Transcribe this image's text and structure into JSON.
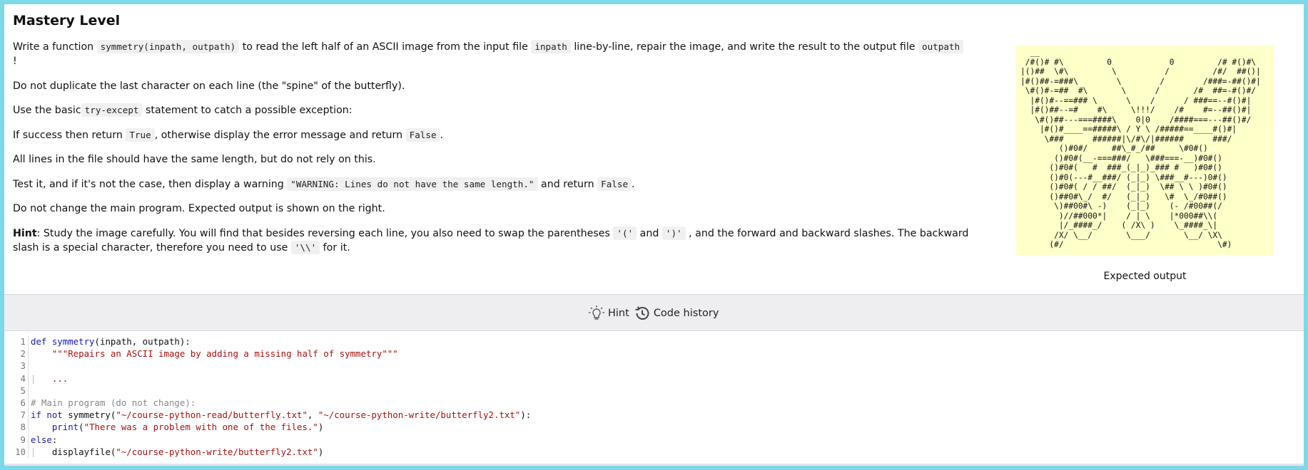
{
  "task": {
    "title": "Mastery Level",
    "p1": {
      "t1": "Write a function ",
      "c1": "symmetry(inpath, outpath)",
      "t2": " to read the left half of an ASCII image from the input file ",
      "c2": "inpath",
      "t3": " line-by-line, repair the image, and write the result to the output file ",
      "c3": "outpath",
      "t4": " !"
    },
    "p2": "Do not duplicate the last character on each line (the \"spine\" of the butterfly).",
    "p3": {
      "t1": "Use the basic",
      "c1": "try-except",
      "t2": " statement to catch a possible exception:"
    },
    "p4": {
      "t1": "If success then return ",
      "c1": "True",
      "t2": ", otherwise display the error message and return ",
      "c2": "False",
      "t3": "."
    },
    "p5": "All lines in the file should have the same length, but do not rely on this.",
    "p6": {
      "t1": "Test it, and if it's not the case, then display a warning ",
      "c1": "\"WARNING: Lines do not have the same length.\"",
      "t2": " and return ",
      "c2": "False",
      "t3": "."
    },
    "p7": "Do not change the main program. Expected output is shown on the right.",
    "p8": {
      "b": "Hint",
      "t1": ": Study the image carefully. You will find that besides reversing each line, you also need to swap the parentheses ",
      "c1": "'('",
      "t2": " and ",
      "c2": "')'",
      "t3": " , and the forward and backward slashes. The backward slash is a special character, therefore you need to use ",
      "c3": "'\\\\'",
      "t4": " for it."
    }
  },
  "expected": {
    "ascii": "  __                                                      __\n /#()# #\\         0            0         /# #()#\\\n|()##  \\#\\         \\          /         /#/  ##()|\n|#()##-=###\\        \\        /        /###=-##()#|\n \\#()#-=##  #\\       \\      /       /#  ##=-#()#/\n  |#()#--==### \\      \\    /      / ###==--#()#|\n  |#()##--=#    #\\     \\!!!/    /#    #=--##()#|\n   \\#()##---===####\\    0|0    /####===---##()#/\n    |#()#____==#####\\ / Y \\ /#####==____#()#|\n     \\###      ######|\\/#\\/|######      ###/\n        ()#0#/     ##\\_#_/##     \\#0#()\n       ()#0#(__-===###/   \\###===-__)#0#()\n      ()#0#(   #  ###_(_|_)_### #   )#0#()\n      ()#0(---#__###/ (_|_) \\###__#---)0#()\n      ()#0#( / / ##/  (_|_)  \\## \\ \\ )#0#()\n      ()##0#\\_/  #/   (_|_)   \\#  \\_/#0##()\n       \\)##00#\\ -)    (_|_)    (- /#00##(/\n        )//##000*|    / | \\    |*000##\\\\(\n        |/_####_/    ( /X\\ )    \\_####_\\|\n       /X/ \\__/       \\___/       \\__/ \\X\\\n      (#/                                \\#)",
    "caption": "Expected output"
  },
  "toolbar": {
    "hint_label": "Hint",
    "history_label": "Code history"
  },
  "editor": {
    "lines": [
      {
        "n": "1",
        "tokens": [
          [
            "kw",
            "def "
          ],
          [
            "fn",
            "symmetry"
          ],
          [
            "",
            "(inpath, outpath):"
          ]
        ]
      },
      {
        "n": "2",
        "tokens": [
          [
            "guide",
            "    "
          ],
          [
            "str",
            "\"\"\"Repairs an ASCII image by adding a missing half of symmetry\"\"\""
          ]
        ]
      },
      {
        "n": "3",
        "tokens": []
      },
      {
        "n": "4",
        "tokens": [
          [
            "guide",
            "|   "
          ],
          [
            "str",
            "..."
          ]
        ]
      },
      {
        "n": "5",
        "tokens": []
      },
      {
        "n": "6",
        "tokens": [
          [
            "cm",
            "# Main program (do not change):"
          ]
        ]
      },
      {
        "n": "7",
        "tokens": [
          [
            "kw",
            "if not "
          ],
          [
            "",
            "symmetry("
          ],
          [
            "str",
            "\"~/course-python-read/butterfly.txt\""
          ],
          [
            "",
            ", "
          ],
          [
            "str",
            "\"~/course-python-write/butterfly2.txt\""
          ],
          [
            "",
            "):"
          ]
        ]
      },
      {
        "n": "8",
        "tokens": [
          [
            "guide",
            "    "
          ],
          [
            "fn",
            "print"
          ],
          [
            "",
            "("
          ],
          [
            "str",
            "\"There was a problem with one of the files.\""
          ],
          [
            "",
            ")"
          ]
        ]
      },
      {
        "n": "9",
        "tokens": [
          [
            "kw",
            "else"
          ],
          [
            "",
            ":"
          ]
        ]
      },
      {
        "n": "10",
        "tokens": [
          [
            "guide",
            "|   "
          ],
          [
            "",
            "displayfile("
          ],
          [
            "str",
            "\"~/course-python-write/butterfly2.txt\""
          ],
          [
            "",
            ")"
          ]
        ]
      }
    ]
  }
}
